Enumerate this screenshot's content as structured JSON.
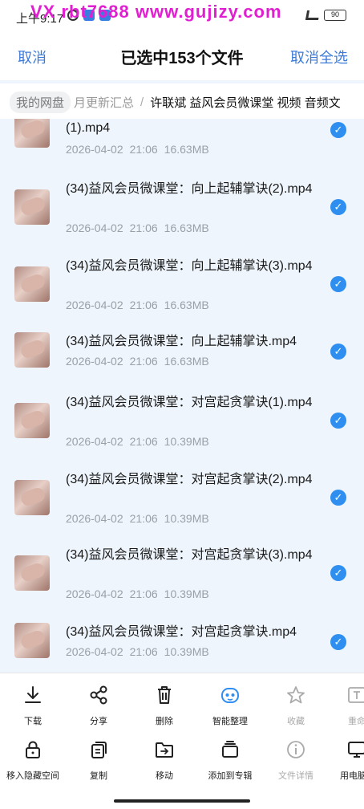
{
  "status_bar": {
    "time": "上午9:17",
    "watermark": "VX rbt7688  www.gujizy.com",
    "battery": "90"
  },
  "header": {
    "cancel": "取消",
    "title": "已选中153个文件",
    "deselect_all": "取消全选"
  },
  "breadcrumb": {
    "root": "我的网盘",
    "middle": "月更新汇总",
    "separator": "/",
    "current": "许联斌 益风会员微课堂 视频 音频文"
  },
  "files": [
    {
      "name": "(1).mp4",
      "date": "2026-04-02",
      "time": "21:06",
      "size": "16.63MB"
    },
    {
      "name": "(34)益风会员微课堂：向上起辅掌诀(2).mp4",
      "date": "2026-04-02",
      "time": "21:06",
      "size": "16.63MB"
    },
    {
      "name": "(34)益风会员微课堂：向上起辅掌诀(3).mp4",
      "date": "2026-04-02",
      "time": "21:06",
      "size": "16.63MB"
    },
    {
      "name": "(34)益风会员微课堂：向上起辅掌诀.mp4",
      "date": "2026-04-02",
      "time": "21:06",
      "size": "16.63MB"
    },
    {
      "name": "(34)益风会员微课堂：对宫起贪掌诀(1).mp4",
      "date": "2026-04-02",
      "time": "21:06",
      "size": "10.39MB"
    },
    {
      "name": "(34)益风会员微课堂：对宫起贪掌诀(2).mp4",
      "date": "2026-04-02",
      "time": "21:06",
      "size": "10.39MB"
    },
    {
      "name": "(34)益风会员微课堂：对宫起贪掌诀(3).mp4",
      "date": "2026-04-02",
      "time": "21:06",
      "size": "10.39MB"
    },
    {
      "name": "(34)益风会员微课堂：对宫起贪掌诀.mp4",
      "date": "2026-04-02",
      "time": "21:06",
      "size": "10.39MB"
    }
  ],
  "actions_row1": [
    {
      "label": "下载",
      "icon": "download-icon"
    },
    {
      "label": "分享",
      "icon": "share-icon"
    },
    {
      "label": "删除",
      "icon": "trash-icon"
    },
    {
      "label": "智能整理",
      "icon": "smart-organize-icon"
    },
    {
      "label": "收藏",
      "icon": "star-icon"
    },
    {
      "label": "重命",
      "icon": "rename-icon"
    }
  ],
  "actions_row2": [
    {
      "label": "移入隐藏空间",
      "icon": "lock-icon"
    },
    {
      "label": "复制",
      "icon": "copy-icon"
    },
    {
      "label": "移动",
      "icon": "move-icon"
    },
    {
      "label": "添加到专辑",
      "icon": "album-icon"
    },
    {
      "label": "文件详情",
      "icon": "info-icon"
    },
    {
      "label": "用电脑",
      "icon": "computer-icon"
    }
  ],
  "colors": {
    "accent": "#3d7bd9",
    "check": "#2f8ff0",
    "list_bg": "#eef5fc",
    "watermark": "#e020d0"
  }
}
